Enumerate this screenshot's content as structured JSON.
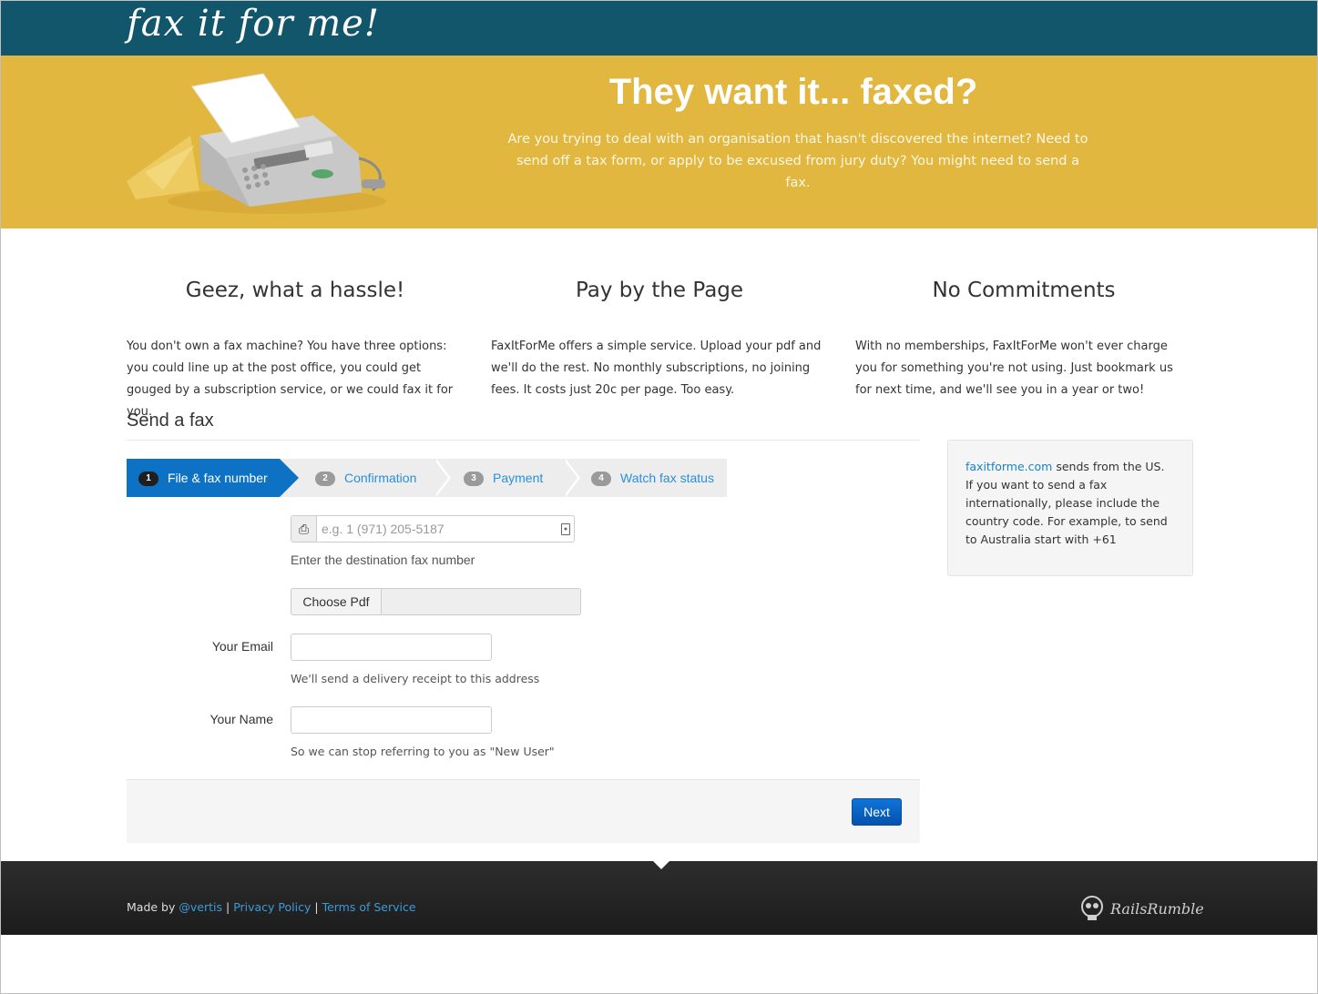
{
  "header": {
    "logo_text": "fax it for me!"
  },
  "hero": {
    "title": "They want it... faxed?",
    "text": "Are you trying to deal with an organisation that hasn't discovered the internet? Need to send off a tax form, or apply to be excused from jury duty? You might need to send a fax.",
    "image_icon": "fax-machine-icon"
  },
  "features": [
    {
      "title": "Geez, what a hassle!",
      "text": "You don't own a fax machine? You have three options: you could line up at the post office, you could get gouged by a subscription service, or we could fax it for you."
    },
    {
      "title": "Pay by the Page",
      "text": "FaxItForMe offers a simple service. Upload your pdf and we'll do the rest. No monthly subscriptions, no joining fees. It costs just 20c per page. Too easy."
    },
    {
      "title": "No Commitments",
      "text": "With no memberships, FaxItForMe won't ever charge you for something you're not using. Just bookmark us for next time, and we'll see you in a year or two!"
    }
  ],
  "form": {
    "section_title": "Send a fax",
    "steps": [
      {
        "num": "1",
        "label": "File & fax number"
      },
      {
        "num": "2",
        "label": "Confirmation"
      },
      {
        "num": "3",
        "label": "Payment"
      },
      {
        "num": "4",
        "label": "Watch fax status"
      }
    ],
    "fax_placeholder": "e.g. 1 (971) 205-5187",
    "fax_value": "",
    "fax_help": "Enter the destination fax number",
    "file_button": "Choose Pdf",
    "email_label": "Your Email",
    "email_value": "",
    "email_help": "We'll send a delivery receipt to this address",
    "name_label": "Your Name",
    "name_value": "",
    "name_help": "So we can stop referring to you as \"New User\"",
    "next_button": "Next"
  },
  "sidebar": {
    "link_text": "faxitforme.com",
    "text": " sends from the US. If you want to send a fax internationally, please include the country code. For example, to send to Australia start with +61"
  },
  "footer": {
    "made_by": "Made by",
    "author_link": "@vertis",
    "sep": "|",
    "privacy_link": "Privacy Policy",
    "terms_link": "Terms of Service",
    "badge_text": "RailsRumble"
  },
  "colors": {
    "topbar": "#11566b",
    "hero": "#e2b73f",
    "accent": "#0d72c4",
    "link": "#1583c9"
  }
}
